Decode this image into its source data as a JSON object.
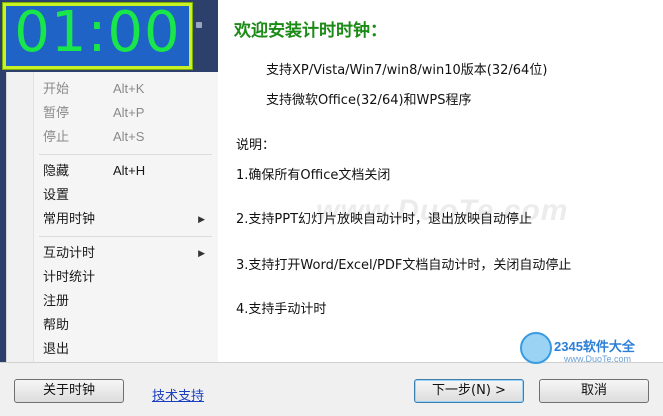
{
  "clock": {
    "time": "01:00"
  },
  "menu": {
    "items": [
      {
        "label": "开始",
        "shortcut": "Alt+K"
      },
      {
        "label": "暂停",
        "shortcut": "Alt+P"
      },
      {
        "label": "停止",
        "shortcut": "Alt+S"
      },
      {
        "label": "隐藏",
        "shortcut": "Alt+H"
      },
      {
        "label": "设置",
        "shortcut": ""
      },
      {
        "label": "常用时钟",
        "shortcut": ""
      },
      {
        "label": "互动计时",
        "shortcut": ""
      },
      {
        "label": "计时统计",
        "shortcut": ""
      },
      {
        "label": "注册",
        "shortcut": ""
      },
      {
        "label": "帮助",
        "shortcut": ""
      },
      {
        "label": "退出",
        "shortcut": ""
      }
    ],
    "submenu_arrow": "▶"
  },
  "content": {
    "welcome": "欢迎安装计时时钟：",
    "support_os": "支持XP/Vista/Win7/win8/win10版本(32/64位)",
    "support_office": "支持微软Office(32/64)和WPS程序",
    "notes_title": "说明：",
    "note1": "1.确保所有Office文档关闭",
    "note2": "2.支持PPT幻灯片放映自动计时，退出放映自动停止",
    "note3": "3.支持打开Word/Excel/PDF文档自动计时，关闭自动停止",
    "note4": "4.支持手动计时",
    "watermark": "www.DuoTe.com"
  },
  "logo": {
    "text": "2345软件大全",
    "url": "www.DuoTe.com"
  },
  "buttons": {
    "about": "关于时钟",
    "tech_support": "技术支持",
    "next": "下一步(N) >",
    "cancel": "取消"
  }
}
